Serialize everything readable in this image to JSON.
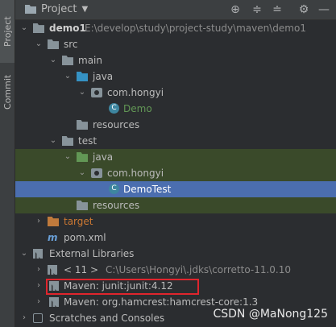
{
  "side_tabs": {
    "project": "Project",
    "commit": "Commit"
  },
  "header": {
    "title": "Project",
    "dropdown_icon": "chevron-down-icon",
    "toolbar": [
      "crosshair-icon",
      "expand-all-icon",
      "collapse-all-icon",
      "gear-icon",
      "minimize-icon"
    ]
  },
  "tree": {
    "demo1": "demo1",
    "demo1_path": "E:\\develop\\study\\project-study\\maven\\demo1",
    "src": "src",
    "main": "main",
    "main_java": "java",
    "main_pkg": "com.hongyi",
    "demo_class": "Demo",
    "main_resources": "resources",
    "test": "test",
    "test_java": "java",
    "test_pkg": "com.hongyi",
    "demotest_class": "DemoTest",
    "test_resources": "resources",
    "target": "target",
    "pom": "pom.xml",
    "ext_libs": "External Libraries",
    "jdk": "< 11 >",
    "jdk_path": "C:\\Users\\Hongyi\\.jdks\\corretto-11.0.10",
    "maven_junit": "Maven: junit:junit:4.12",
    "maven_hamcrest": "Maven: org.hamcrest:hamcrest-core:1.3",
    "scratches": "Scratches and Consoles"
  },
  "watermark": "CSDN @MaNong125",
  "colors": {
    "selection": "#4b6eaf",
    "test_row_bg": "#3a4a2a",
    "highlight_box": "#e0252d"
  }
}
